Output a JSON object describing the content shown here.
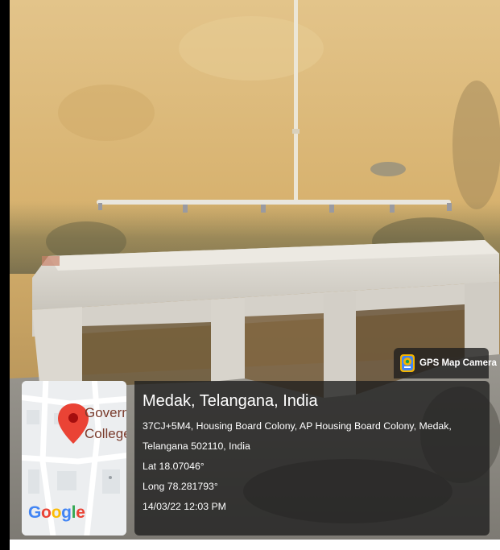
{
  "badge": {
    "label": "GPS Map Camera",
    "icon": "camera-pin-icon"
  },
  "location": {
    "title": "Medak, Telangana, India",
    "address_line1": "37CJ+5M4, Housing Board Colony, AP Housing Board Colony, Medak,",
    "address_line2": "Telangana 502110, India",
    "latitude": "Lat 18.07046°",
    "longitude": "Long 78.281793°",
    "datetime": "14/03/22 12:03 PM"
  },
  "map": {
    "brand": "Google",
    "place_line1": "Govern",
    "place_line2": "College",
    "pin_color": "#ea4335"
  },
  "colors": {
    "wall": "#d8b36f",
    "concrete": "#d9d6cf",
    "overlay": "#1e1e1e"
  }
}
